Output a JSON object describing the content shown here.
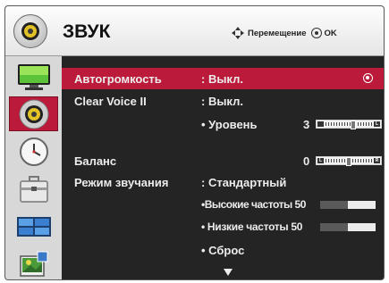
{
  "header": {
    "title": "ЗВУК",
    "nav_hint": "Перемещение",
    "ok_label": "OK"
  },
  "sidebar": {
    "items": [
      {
        "name": "picture",
        "icon": "monitor-icon",
        "active": false
      },
      {
        "name": "sound",
        "icon": "speaker-icon",
        "active": true
      },
      {
        "name": "time",
        "icon": "clock-icon",
        "active": false
      },
      {
        "name": "option",
        "icon": "toolbox-icon",
        "active": false
      },
      {
        "name": "pip",
        "icon": "split-screen-icon",
        "active": false
      },
      {
        "name": "input",
        "icon": "input-icon",
        "active": false
      }
    ]
  },
  "menu": {
    "auto_volume": {
      "label": "Автогромкость",
      "value": ": Выкл."
    },
    "clear_voice": {
      "label": "Clear Voice II",
      "value": ": Выкл."
    },
    "level": {
      "label": "• Уровень",
      "value": "3",
      "slider_level": 0.6,
      "slider_end": "L"
    },
    "balance": {
      "label": "Баланс",
      "value": "0",
      "slider_start": "L",
      "slider_end": "R",
      "slider_level": 0.5
    },
    "sound_mode": {
      "label": "Режим звучания",
      "value": ": Стандартный"
    },
    "treble": {
      "label": "•Высокие частоты 50",
      "level": 0.5
    },
    "bass": {
      "label": "• Низкие частоты 50",
      "level": 0.5
    },
    "reset": {
      "label": "• Сброс"
    }
  },
  "colors": {
    "accent": "#bc1a3a",
    "panel": "#242424"
  }
}
